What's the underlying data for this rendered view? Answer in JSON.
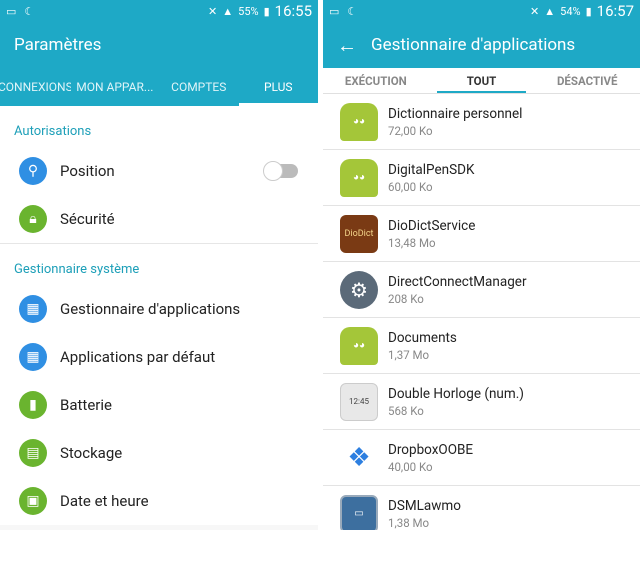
{
  "left": {
    "status": {
      "battery": "55%",
      "time": "16:55"
    },
    "title": "Paramètres",
    "tabs": [
      {
        "label": "CONNEXIONS",
        "active": false
      },
      {
        "label": "MON APPAR...",
        "active": false
      },
      {
        "label": "COMPTES",
        "active": false
      },
      {
        "label": "PLUS",
        "active": true
      }
    ],
    "section1": {
      "title": "Autorisations",
      "items": [
        {
          "label": "Position",
          "icon": "location-icon",
          "color": "#2f8fe3"
        },
        {
          "label": "Sécurité",
          "icon": "lock-icon",
          "color": "#6ab42f"
        }
      ]
    },
    "section2": {
      "title": "Gestionnaire système",
      "items": [
        {
          "label": "Gestionnaire d'applications",
          "icon": "apps-grid-icon",
          "color": "#2f8fe3"
        },
        {
          "label": "Applications par défaut",
          "icon": "default-apps-icon",
          "color": "#2f8fe3"
        },
        {
          "label": "Batterie",
          "icon": "battery-icon",
          "color": "#6ab42f"
        },
        {
          "label": "Stockage",
          "icon": "storage-icon",
          "color": "#6ab42f"
        },
        {
          "label": "Date et heure",
          "icon": "calendar-icon",
          "color": "#6ab42f"
        }
      ]
    }
  },
  "right": {
    "status": {
      "battery": "54%",
      "time": "16:57"
    },
    "title": "Gestionnaire d'applications",
    "tabs": [
      {
        "label": "EXÉCUTION",
        "active": false
      },
      {
        "label": "TOUT",
        "active": true
      },
      {
        "label": "DÉSACTIVÉ",
        "active": false
      }
    ],
    "apps": [
      {
        "name": "Dictionnaire personnel",
        "size": "72,00 Ko",
        "icon": "android-icon"
      },
      {
        "name": "DigitalPenSDK",
        "size": "60,00 Ko",
        "icon": "android-icon"
      },
      {
        "name": "DioDictService",
        "size": "13,48 Mo",
        "icon": "diodict-icon"
      },
      {
        "name": "DirectConnectManager",
        "size": "208 Ko",
        "icon": "gear-icon"
      },
      {
        "name": "Documents",
        "size": "1,37 Mo",
        "icon": "android-icon"
      },
      {
        "name": "Double Horloge (num.)",
        "size": "568 Ko",
        "icon": "clock-icon"
      },
      {
        "name": "DropboxOOBE",
        "size": "40,00 Ko",
        "icon": "dropbox-icon"
      },
      {
        "name": "DSMLawmo",
        "size": "1,38 Mo",
        "icon": "dsm-icon"
      }
    ],
    "icon_texts": {
      "diodict": "DioDict",
      "clock": "12:45"
    }
  },
  "colors": {
    "accent": "#1ea9c6",
    "section_title": "#1d9fb8"
  }
}
